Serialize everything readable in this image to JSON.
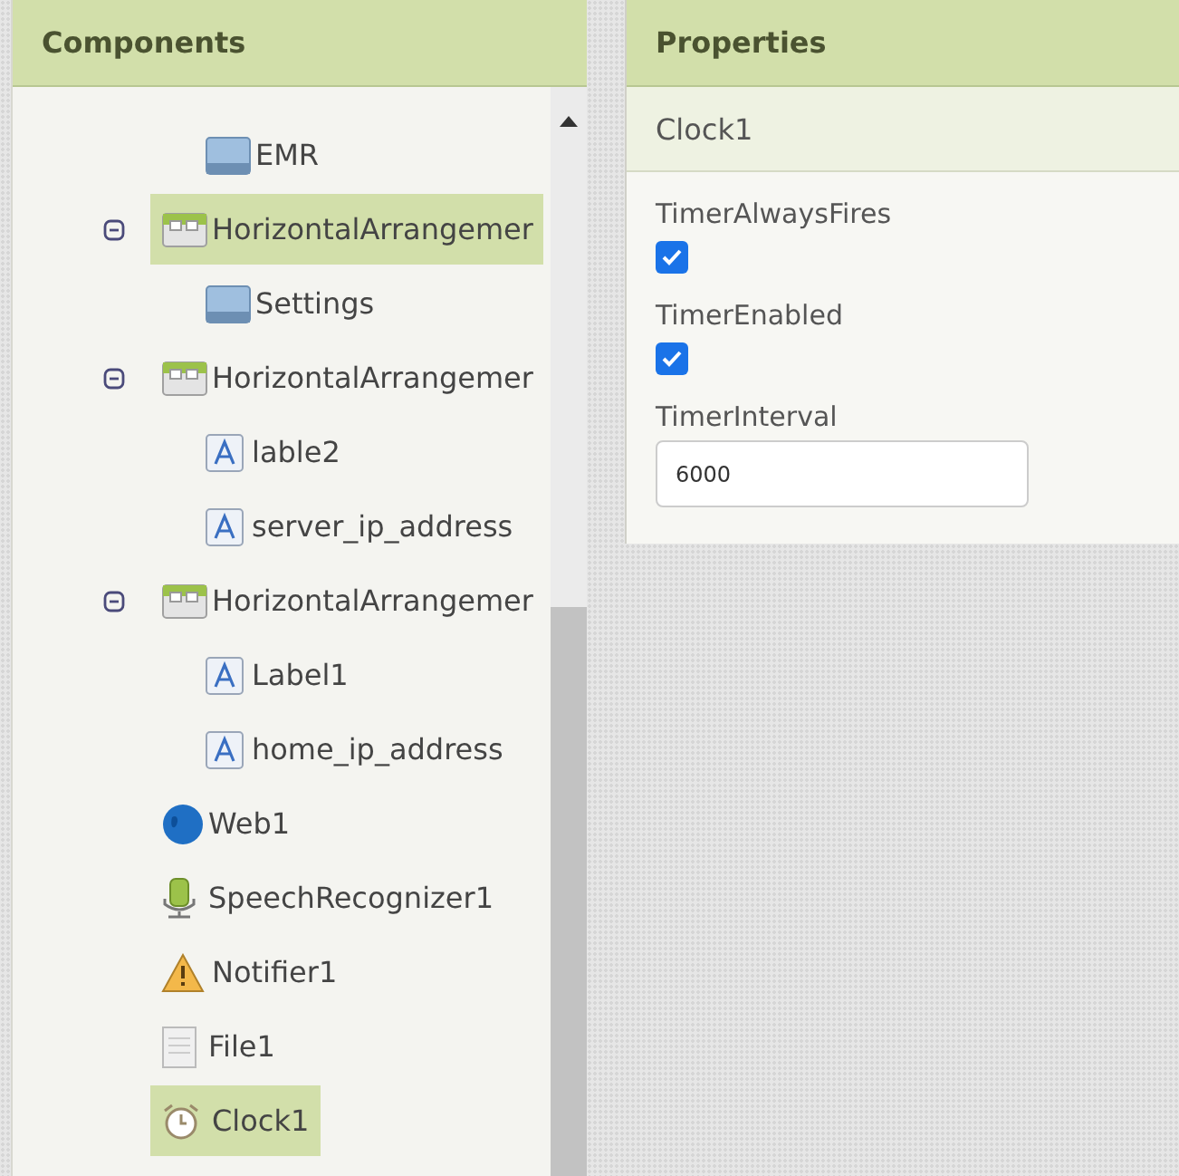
{
  "components": {
    "title": "Components",
    "tree": {
      "continued_children": [
        {
          "label": "EMR",
          "kind": "button",
          "selected": false
        }
      ],
      "items": [
        {
          "label": "HorizontalArrangemer",
          "kind": "arrangement",
          "selected": true,
          "expanded": true,
          "children": [
            {
              "label": "Settings",
              "kind": "button",
              "selected": false
            }
          ]
        },
        {
          "label": "HorizontalArrangemer",
          "kind": "arrangement",
          "selected": false,
          "expanded": true,
          "children": [
            {
              "label": "lable2",
              "kind": "label",
              "selected": false
            },
            {
              "label": "server_ip_address",
              "kind": "label",
              "selected": false
            }
          ]
        },
        {
          "label": "HorizontalArrangemer",
          "kind": "arrangement",
          "selected": false,
          "expanded": true,
          "children": [
            {
              "label": "Label1",
              "kind": "label",
              "selected": false
            },
            {
              "label": "home_ip_address",
              "kind": "label",
              "selected": false
            }
          ]
        },
        {
          "label": "Web1",
          "kind": "web",
          "selected": false
        },
        {
          "label": "SpeechRecognizer1",
          "kind": "speech",
          "selected": false
        },
        {
          "label": "Notifier1",
          "kind": "notifier",
          "selected": false
        },
        {
          "label": "File1",
          "kind": "file",
          "selected": false
        },
        {
          "label": "Clock1",
          "kind": "clock",
          "selected": true
        }
      ]
    }
  },
  "properties": {
    "title": "Properties",
    "component": "Clock1",
    "fields": [
      {
        "label": "TimerAlwaysFires",
        "kind": "checkbox",
        "checked": true
      },
      {
        "label": "TimerEnabled",
        "kind": "checkbox",
        "checked": true
      },
      {
        "label": "TimerInterval",
        "kind": "text",
        "value": "6000"
      }
    ]
  }
}
